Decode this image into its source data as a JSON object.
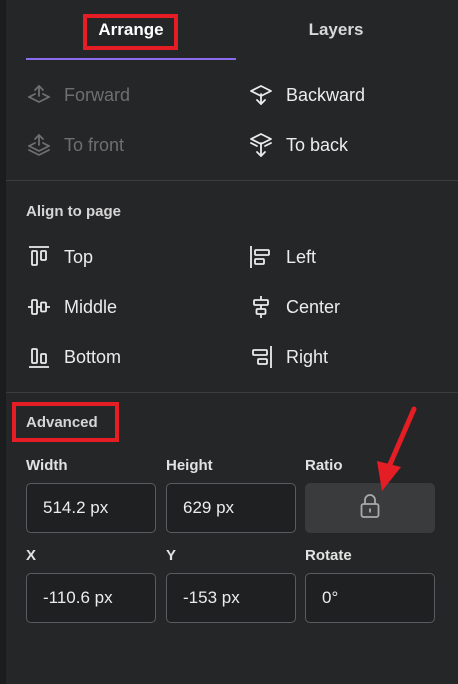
{
  "tabs": {
    "arrange": "Arrange",
    "layers": "Layers"
  },
  "order": {
    "forward": "Forward",
    "to_front": "To front",
    "backward": "Backward",
    "to_back": "To back"
  },
  "align": {
    "title": "Align to page",
    "top": "Top",
    "middle": "Middle",
    "bottom": "Bottom",
    "left": "Left",
    "center": "Center",
    "right": "Right"
  },
  "advanced": {
    "title": "Advanced",
    "width_label": "Width",
    "width_value": "514.2 px",
    "height_label": "Height",
    "height_value": "629 px",
    "ratio_label": "Ratio",
    "x_label": "X",
    "x_value": "-110.6 px",
    "y_label": "Y",
    "y_value": "-153 px",
    "rotate_label": "Rotate",
    "rotate_value": "0°"
  },
  "colors": {
    "background": "#252627",
    "accent_underline": "#8b6cf1",
    "highlight_red": "#e51d24",
    "disabled_text": "#6e6f71"
  },
  "icons": {
    "forward": "layer-up-icon",
    "to_front": "layer-top-icon",
    "backward": "layer-down-icon",
    "to_back": "layer-bottom-icon",
    "ratio": "lock-icon"
  }
}
